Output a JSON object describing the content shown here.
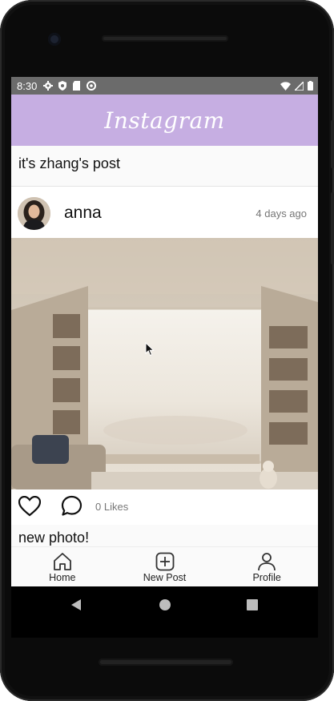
{
  "status_bar": {
    "time": "8:30"
  },
  "header": {
    "title": "Instagram",
    "color": "#c6aee2"
  },
  "top_post": {
    "caption": "it's zhang's post"
  },
  "post": {
    "username": "anna",
    "timestamp": "4 days ago",
    "likes": "0 Likes",
    "caption": "new photo!",
    "image_subject": "sunlit room with bookshelves and a window"
  },
  "bottom_nav": {
    "items": [
      {
        "label": "Home",
        "icon": "home-icon"
      },
      {
        "label": "New Post",
        "icon": "add-square-icon"
      },
      {
        "label": "Profile",
        "icon": "person-icon"
      }
    ]
  },
  "system_nav": {
    "icons": [
      "back-icon",
      "home-circle-icon",
      "recents-icon"
    ]
  }
}
